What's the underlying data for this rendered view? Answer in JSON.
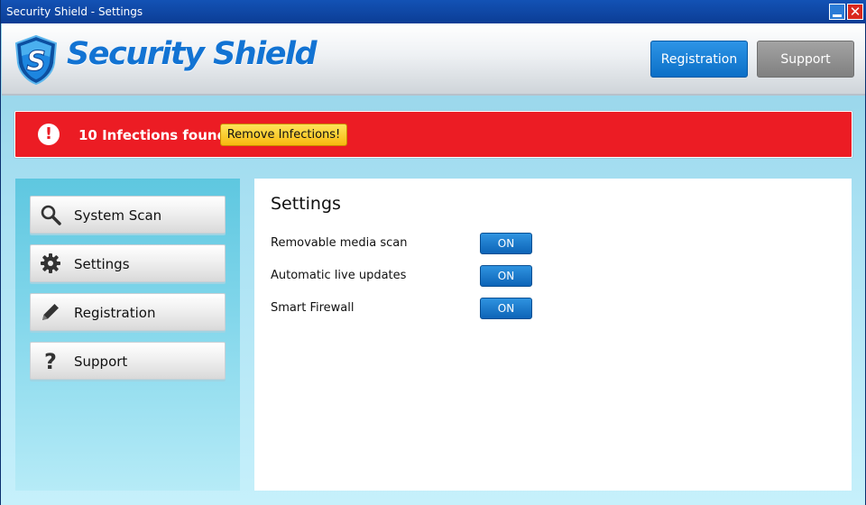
{
  "window": {
    "title": "Security Shield - Settings",
    "minimize_glyph": "",
    "close_glyph": "✕"
  },
  "header": {
    "logo_text": "Security Shield",
    "logo_letter": "S",
    "buttons": {
      "registration": "Registration",
      "support": "Support"
    }
  },
  "alert": {
    "icon": "!",
    "message": "10 Infections found.",
    "action_label": "Remove Infections!"
  },
  "sidebar": {
    "items": [
      {
        "label": "System Scan",
        "icon": "search-icon"
      },
      {
        "label": "Settings",
        "icon": "gear-icon"
      },
      {
        "label": "Registration",
        "icon": "pencil-icon"
      },
      {
        "label": "Support",
        "icon": "question-icon"
      }
    ]
  },
  "main": {
    "title": "Settings",
    "settings": [
      {
        "label": "Removable media scan",
        "state": "ON"
      },
      {
        "label": "Automatic live updates",
        "state": "ON"
      },
      {
        "label": "Smart Firewall",
        "state": "ON"
      }
    ]
  },
  "colors": {
    "titlebar": "#0b3d95",
    "brand_blue": "#1273d3",
    "alert_red": "#ec1c24",
    "action_yellow": "#f8b90f",
    "toggle_blue": "#0d64b7"
  }
}
